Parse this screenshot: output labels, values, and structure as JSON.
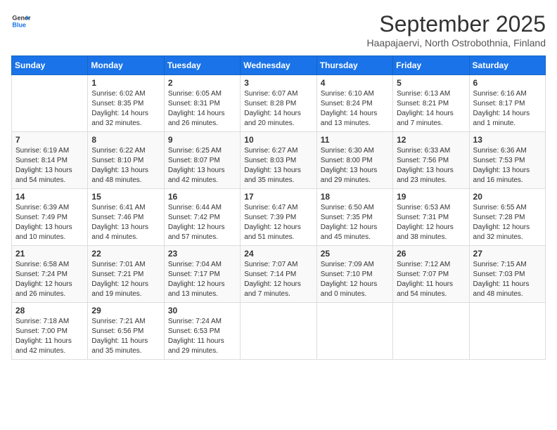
{
  "header": {
    "logo_general": "General",
    "logo_blue": "Blue",
    "month_title": "September 2025",
    "subtitle": "Haapajaervi, North Ostrobothnia, Finland"
  },
  "days_of_week": [
    "Sunday",
    "Monday",
    "Tuesday",
    "Wednesday",
    "Thursday",
    "Friday",
    "Saturday"
  ],
  "weeks": [
    [
      {
        "day": "",
        "info": ""
      },
      {
        "day": "1",
        "info": "Sunrise: 6:02 AM\nSunset: 8:35 PM\nDaylight: 14 hours\nand 32 minutes."
      },
      {
        "day": "2",
        "info": "Sunrise: 6:05 AM\nSunset: 8:31 PM\nDaylight: 14 hours\nand 26 minutes."
      },
      {
        "day": "3",
        "info": "Sunrise: 6:07 AM\nSunset: 8:28 PM\nDaylight: 14 hours\nand 20 minutes."
      },
      {
        "day": "4",
        "info": "Sunrise: 6:10 AM\nSunset: 8:24 PM\nDaylight: 14 hours\nand 13 minutes."
      },
      {
        "day": "5",
        "info": "Sunrise: 6:13 AM\nSunset: 8:21 PM\nDaylight: 14 hours\nand 7 minutes."
      },
      {
        "day": "6",
        "info": "Sunrise: 6:16 AM\nSunset: 8:17 PM\nDaylight: 14 hours\nand 1 minute."
      }
    ],
    [
      {
        "day": "7",
        "info": "Sunrise: 6:19 AM\nSunset: 8:14 PM\nDaylight: 13 hours\nand 54 minutes."
      },
      {
        "day": "8",
        "info": "Sunrise: 6:22 AM\nSunset: 8:10 PM\nDaylight: 13 hours\nand 48 minutes."
      },
      {
        "day": "9",
        "info": "Sunrise: 6:25 AM\nSunset: 8:07 PM\nDaylight: 13 hours\nand 42 minutes."
      },
      {
        "day": "10",
        "info": "Sunrise: 6:27 AM\nSunset: 8:03 PM\nDaylight: 13 hours\nand 35 minutes."
      },
      {
        "day": "11",
        "info": "Sunrise: 6:30 AM\nSunset: 8:00 PM\nDaylight: 13 hours\nand 29 minutes."
      },
      {
        "day": "12",
        "info": "Sunrise: 6:33 AM\nSunset: 7:56 PM\nDaylight: 13 hours\nand 23 minutes."
      },
      {
        "day": "13",
        "info": "Sunrise: 6:36 AM\nSunset: 7:53 PM\nDaylight: 13 hours\nand 16 minutes."
      }
    ],
    [
      {
        "day": "14",
        "info": "Sunrise: 6:39 AM\nSunset: 7:49 PM\nDaylight: 13 hours\nand 10 minutes."
      },
      {
        "day": "15",
        "info": "Sunrise: 6:41 AM\nSunset: 7:46 PM\nDaylight: 13 hours\nand 4 minutes."
      },
      {
        "day": "16",
        "info": "Sunrise: 6:44 AM\nSunset: 7:42 PM\nDaylight: 12 hours\nand 57 minutes."
      },
      {
        "day": "17",
        "info": "Sunrise: 6:47 AM\nSunset: 7:39 PM\nDaylight: 12 hours\nand 51 minutes."
      },
      {
        "day": "18",
        "info": "Sunrise: 6:50 AM\nSunset: 7:35 PM\nDaylight: 12 hours\nand 45 minutes."
      },
      {
        "day": "19",
        "info": "Sunrise: 6:53 AM\nSunset: 7:31 PM\nDaylight: 12 hours\nand 38 minutes."
      },
      {
        "day": "20",
        "info": "Sunrise: 6:55 AM\nSunset: 7:28 PM\nDaylight: 12 hours\nand 32 minutes."
      }
    ],
    [
      {
        "day": "21",
        "info": "Sunrise: 6:58 AM\nSunset: 7:24 PM\nDaylight: 12 hours\nand 26 minutes."
      },
      {
        "day": "22",
        "info": "Sunrise: 7:01 AM\nSunset: 7:21 PM\nDaylight: 12 hours\nand 19 minutes."
      },
      {
        "day": "23",
        "info": "Sunrise: 7:04 AM\nSunset: 7:17 PM\nDaylight: 12 hours\nand 13 minutes."
      },
      {
        "day": "24",
        "info": "Sunrise: 7:07 AM\nSunset: 7:14 PM\nDaylight: 12 hours\nand 7 minutes."
      },
      {
        "day": "25",
        "info": "Sunrise: 7:09 AM\nSunset: 7:10 PM\nDaylight: 12 hours\nand 0 minutes."
      },
      {
        "day": "26",
        "info": "Sunrise: 7:12 AM\nSunset: 7:07 PM\nDaylight: 11 hours\nand 54 minutes."
      },
      {
        "day": "27",
        "info": "Sunrise: 7:15 AM\nSunset: 7:03 PM\nDaylight: 11 hours\nand 48 minutes."
      }
    ],
    [
      {
        "day": "28",
        "info": "Sunrise: 7:18 AM\nSunset: 7:00 PM\nDaylight: 11 hours\nand 42 minutes."
      },
      {
        "day": "29",
        "info": "Sunrise: 7:21 AM\nSunset: 6:56 PM\nDaylight: 11 hours\nand 35 minutes."
      },
      {
        "day": "30",
        "info": "Sunrise: 7:24 AM\nSunset: 6:53 PM\nDaylight: 11 hours\nand 29 minutes."
      },
      {
        "day": "",
        "info": ""
      },
      {
        "day": "",
        "info": ""
      },
      {
        "day": "",
        "info": ""
      },
      {
        "day": "",
        "info": ""
      }
    ]
  ]
}
